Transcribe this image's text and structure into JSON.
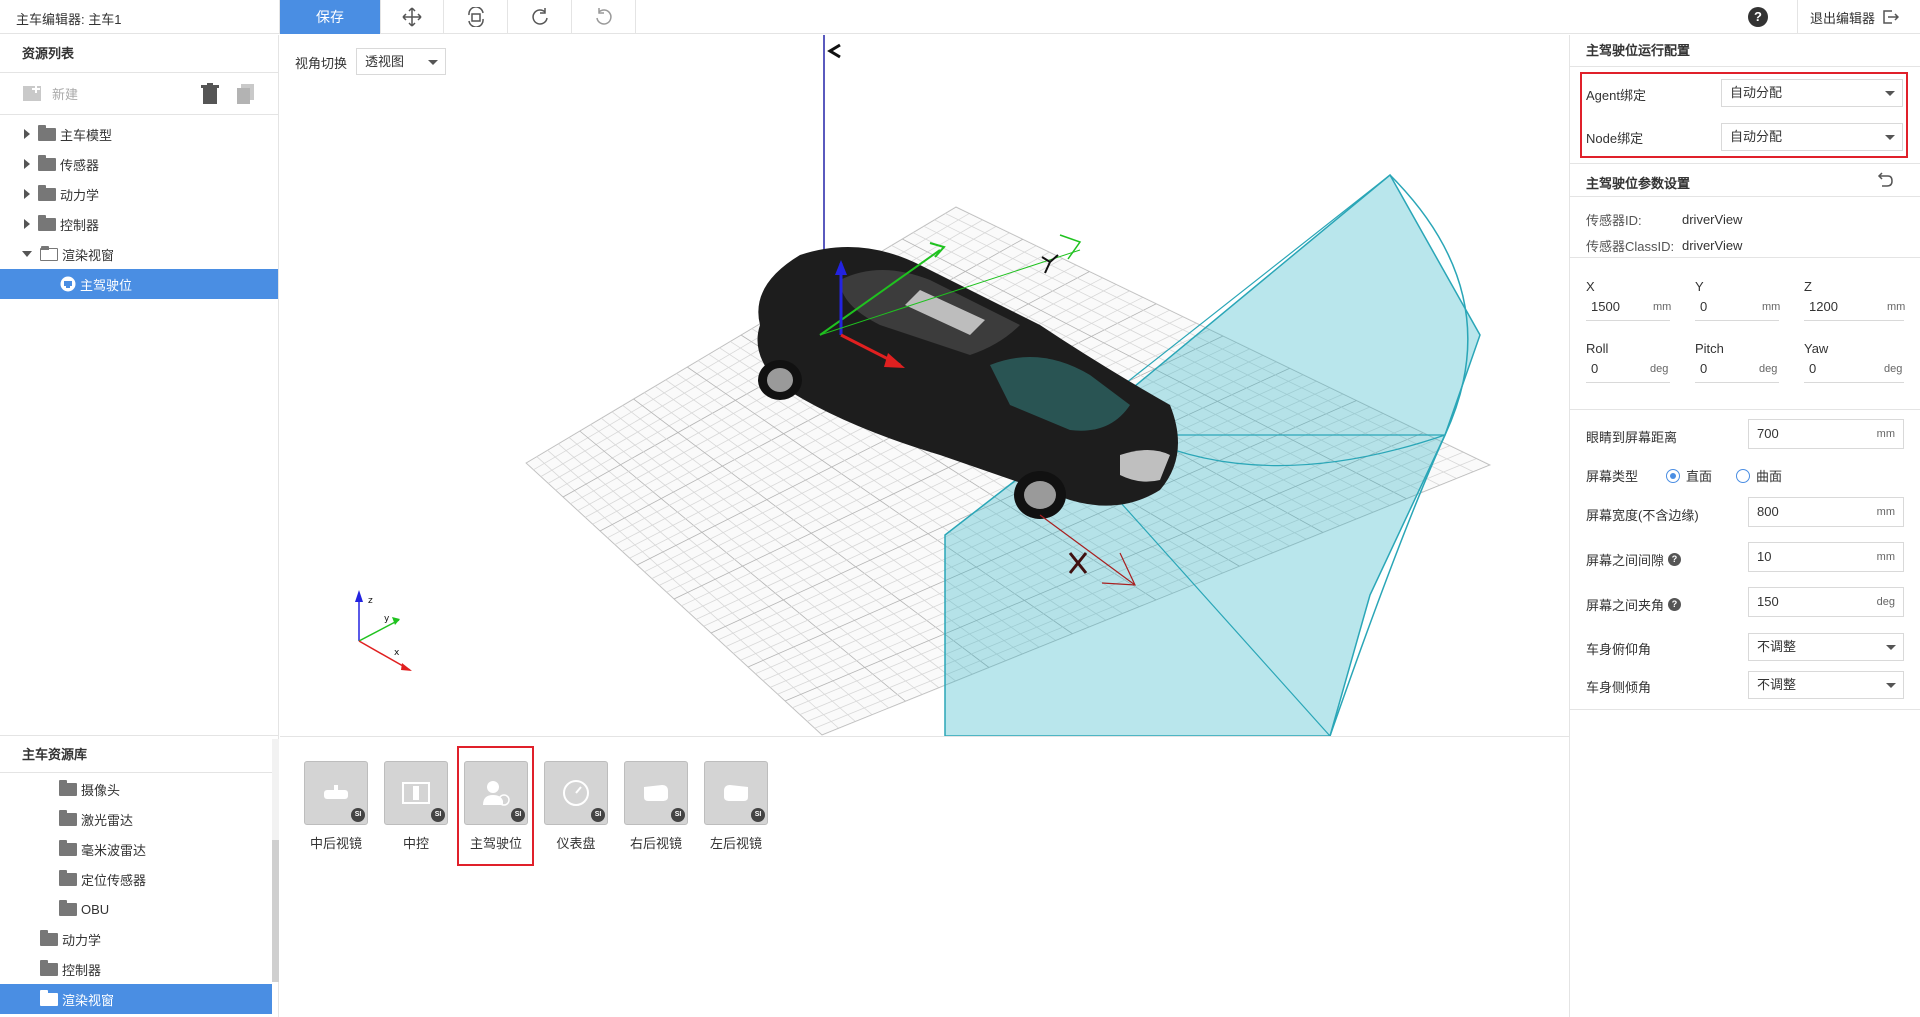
{
  "topbar": {
    "title": "主车编辑器: 主车1",
    "save_label": "保存",
    "tools": [
      "move-icon",
      "reset-view-icon",
      "redo-icon",
      "undo-icon"
    ],
    "exit_label": "退出编辑器"
  },
  "left": {
    "resource_title": "资源列表",
    "new_label": "新建",
    "tree": [
      {
        "label": "主车模型",
        "expanded": false
      },
      {
        "label": "传感器",
        "expanded": false
      },
      {
        "label": "动力学",
        "expanded": false
      },
      {
        "label": "控制器",
        "expanded": false
      },
      {
        "label": "渲染视窗",
        "expanded": true
      },
      {
        "label": "主驾驶位",
        "selected": true
      }
    ],
    "library_title": "主车资源库",
    "library": [
      {
        "label": "摄像头"
      },
      {
        "label": "激光雷达"
      },
      {
        "label": "毫米波雷达"
      },
      {
        "label": "定位传感器"
      },
      {
        "label": "OBU"
      },
      {
        "label": "动力学"
      },
      {
        "label": "控制器"
      },
      {
        "label": "渲染视窗",
        "selected": true
      }
    ]
  },
  "viewport": {
    "view_label": "视角切换",
    "view_value": "透视图"
  },
  "bottom": {
    "cards": [
      {
        "label": "中后视镜",
        "badge": "SI"
      },
      {
        "label": "中控",
        "badge": "SI"
      },
      {
        "label": "主驾驶位",
        "badge": "SI"
      },
      {
        "label": "仪表盘",
        "badge": "SI"
      },
      {
        "label": "右后视镜",
        "badge": "SI"
      },
      {
        "label": "左后视镜",
        "badge": "SI"
      }
    ]
  },
  "right": {
    "run_title": "主驾驶位运行配置",
    "agent_label": "Agent绑定",
    "agent_value": "自动分配",
    "node_label": "Node绑定",
    "node_value": "自动分配",
    "param_title": "主驾驶位参数设置",
    "sensor_id_label": "传感器ID:",
    "sensor_id_value": "driverView",
    "sensor_class_label": "传感器ClassID:",
    "sensor_class_value": "driverView",
    "x_label": "X",
    "x_value": "1500",
    "x_unit": "mm",
    "y_label": "Y",
    "y_value": "0",
    "y_unit": "mm",
    "z_label": "Z",
    "z_value": "1200",
    "z_unit": "mm",
    "roll_label": "Roll",
    "roll_value": "0",
    "roll_unit": "deg",
    "pitch_label": "Pitch",
    "pitch_value": "0",
    "pitch_unit": "deg",
    "yaw_label": "Yaw",
    "yaw_value": "0",
    "yaw_unit": "deg",
    "eye_label": "眼睛到屏幕距离",
    "eye_value": "700",
    "eye_unit": "mm",
    "screen_type_label": "屏幕类型",
    "screen_flat": "直面",
    "screen_curved": "曲面",
    "screen_width_label": "屏幕宽度(不含边缘)",
    "screen_width_value": "800",
    "screen_width_unit": "mm",
    "gap_label": "屏幕之间间隙",
    "gap_value": "10",
    "gap_unit": "mm",
    "angle_label": "屏幕之间夹角",
    "angle_value": "150",
    "angle_unit": "deg",
    "pitch_body_label": "车身俯仰角",
    "pitch_body_value": "不调整",
    "roll_body_label": "车身侧倾角",
    "roll_body_value": "不调整"
  },
  "colors": {
    "accent": "#4a8ee3",
    "highlight": "#e0202a",
    "frustum": "#2bb3c4"
  }
}
